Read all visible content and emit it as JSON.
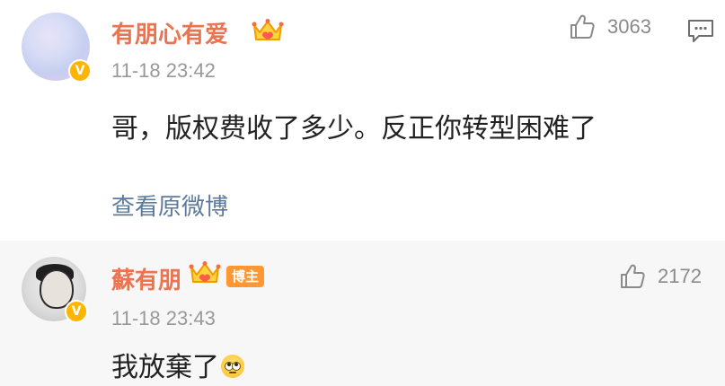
{
  "comments": [
    {
      "username": "有朋心有爱",
      "timestamp": "11-18 23:42",
      "text": "哥，版权费收了多少。反正你转型困难了",
      "like_count": "3063",
      "view_original_link": "查看原微博",
      "verified_badge": "V",
      "crown_icon": "crown-icon"
    },
    {
      "username": "蘇有朋",
      "blogger_tag": "博主",
      "timestamp": "11-18 23:43",
      "text": "我放棄了",
      "like_count": "2172",
      "verified_badge": "V",
      "crown_icon": "crown-icon",
      "emoji": "eye-roll-emoji"
    }
  ],
  "colors": {
    "username": "#eb7350",
    "link": "#5d7a9c",
    "timestamp": "#999999",
    "badge": "#ffb400",
    "blogger_tag": "#ff9832",
    "reply_background": "#f7f7f7"
  }
}
